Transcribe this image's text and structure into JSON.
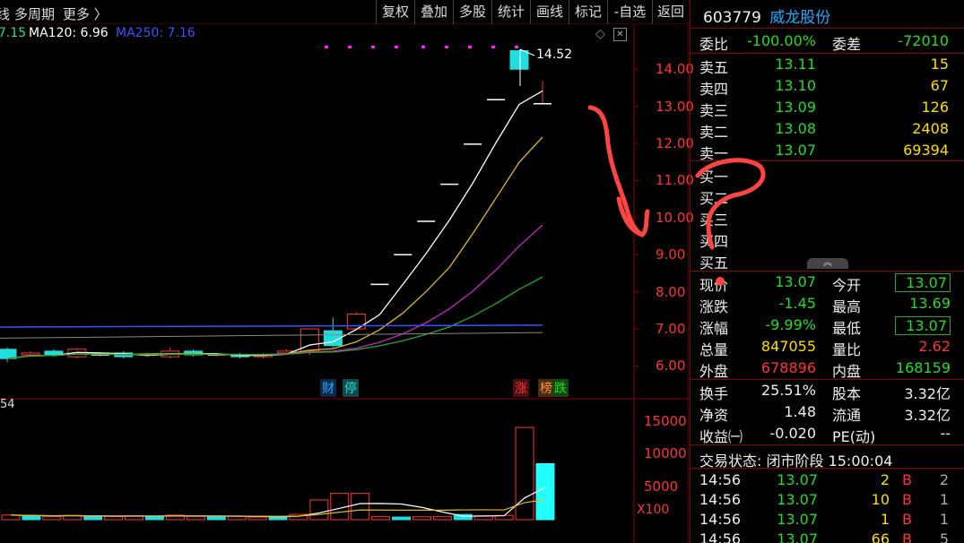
{
  "toolbar": {
    "left_items": [
      "线",
      "多周期",
      "更多 〉"
    ],
    "buttons": [
      "复权",
      "叠加",
      "多股",
      "统计",
      "画线",
      "标记",
      "-自选",
      "返回"
    ]
  },
  "ma_legend": [
    {
      "text": "7.15",
      "color": "#22dd99"
    },
    {
      "text": "MA120: 6.96",
      "color": "#ffffff"
    },
    {
      "text": "MA250: 7.16",
      "color": "#3355ff"
    }
  ],
  "chart_data": [
    {
      "type": "candlestick",
      "title": "",
      "y_axis_ticks": [
        "14.00",
        "13.00",
        "12.00",
        "11.00",
        "10.00",
        "9.00",
        "8.00",
        "7.00",
        "6.00"
      ],
      "ylim": [
        5.6,
        14.9
      ],
      "annotation_high": "14.52",
      "candles": [
        {
          "o": 6.45,
          "c": 6.2,
          "h": 6.5,
          "l": 6.1
        },
        {
          "o": 6.3,
          "c": 6.35,
          "h": 6.4,
          "l": 6.25
        },
        {
          "o": 6.4,
          "c": 6.3,
          "h": 6.45,
          "l": 6.25
        },
        {
          "o": 6.25,
          "c": 6.45,
          "h": 6.5,
          "l": 6.2
        },
        {
          "o": 6.3,
          "c": 6.3,
          "h": 6.35,
          "l": 6.25
        },
        {
          "o": 6.35,
          "c": 6.25,
          "h": 6.4,
          "l": 6.2
        },
        {
          "o": 6.3,
          "c": 6.3,
          "h": 6.35,
          "l": 6.25
        },
        {
          "o": 6.25,
          "c": 6.4,
          "h": 6.5,
          "l": 6.2
        },
        {
          "o": 6.4,
          "c": 6.3,
          "h": 6.45,
          "l": 6.25
        },
        {
          "o": 6.3,
          "c": 6.3,
          "h": 6.35,
          "l": 6.25
        },
        {
          "o": 6.3,
          "c": 6.25,
          "h": 6.35,
          "l": 6.2
        },
        {
          "o": 6.25,
          "c": 6.3,
          "h": 6.35,
          "l": 6.2
        },
        {
          "o": 6.35,
          "c": 6.4,
          "h": 6.45,
          "l": 6.3
        },
        {
          "o": 6.4,
          "c": 7.0,
          "h": 7.0,
          "l": 6.3
        },
        {
          "o": 6.95,
          "c": 6.55,
          "h": 7.3,
          "l": 6.5
        },
        {
          "o": 7.0,
          "c": 7.4,
          "h": 7.45,
          "l": 7.0
        },
        {
          "o": 8.2,
          "c": 8.2,
          "h": 8.2,
          "l": 8.2
        },
        {
          "o": 9.0,
          "c": 9.0,
          "h": 9.0,
          "l": 9.0
        },
        {
          "o": 9.9,
          "c": 9.9,
          "h": 9.9,
          "l": 9.9
        },
        {
          "o": 10.9,
          "c": 10.9,
          "h": 10.9,
          "l": 10.9
        },
        {
          "o": 11.98,
          "c": 11.98,
          "h": 11.98,
          "l": 11.98
        },
        {
          "o": 13.18,
          "c": 13.18,
          "h": 13.18,
          "l": 13.18
        },
        {
          "o": 14.5,
          "c": 14.0,
          "h": 14.52,
          "l": 14.0
        },
        {
          "o": 13.07,
          "c": 13.07,
          "h": 13.69,
          "l": 13.07
        }
      ],
      "bottom_tags": [
        {
          "text": "财",
          "color": "#22aaff",
          "bg": "#0a2a4a"
        },
        {
          "text": "停",
          "color": "#22dddd",
          "bg": "#104a4a"
        },
        {
          "text": "涨",
          "color": "#ff3333",
          "bg": "#4a1010"
        },
        {
          "text": "榜",
          "color": "#ff9933",
          "bg": "#4a2a10"
        },
        {
          "text": "跌",
          "color": "#22dd22",
          "bg": "#104a10"
        }
      ]
    },
    {
      "type": "bar",
      "title": "",
      "y_axis_ticks": [
        "15000",
        "10000",
        "5000"
      ],
      "unit": "X100",
      "top_left_label": "54",
      "volumes": [
        700,
        600,
        500,
        650,
        450,
        500,
        600,
        550,
        700,
        500,
        450,
        500,
        400,
        450,
        800,
        3000,
        4000,
        4000,
        500,
        400,
        450,
        500,
        800,
        600,
        650,
        14000,
        8500
      ]
    }
  ],
  "quote": {
    "code": "603779",
    "name": "威龙股份",
    "weibi_label": "委比",
    "weibi": "-100.00%",
    "weicha_label": "委差",
    "weicha": "-72010",
    "sells": [
      {
        "label": "卖五",
        "price": "13.11",
        "vol": "15"
      },
      {
        "label": "卖四",
        "price": "13.10",
        "vol": "67"
      },
      {
        "label": "卖三",
        "price": "13.09",
        "vol": "126"
      },
      {
        "label": "卖二",
        "price": "13.08",
        "vol": "2408"
      },
      {
        "label": "卖一",
        "price": "13.07",
        "vol": "69394"
      }
    ],
    "buys": [
      "买一",
      "买二",
      "买三",
      "买四",
      "买五"
    ],
    "stats": [
      {
        "l1": "现价",
        "v1": "13.07",
        "c1": "g",
        "l2": "今开",
        "v2": "13.07",
        "c2": "g",
        "b2": true
      },
      {
        "l1": "涨跌",
        "v1": "-1.45",
        "c1": "g",
        "l2": "最高",
        "v2": "13.69",
        "c2": "g",
        "b2": false
      },
      {
        "l1": "涨幅",
        "v1": "-9.99%",
        "c1": "g",
        "l2": "最低",
        "v2": "13.07",
        "c2": "g",
        "b2": true
      },
      {
        "l1": "总量",
        "v1": "847055",
        "c1": "y",
        "l2": "量比",
        "v2": "2.62",
        "c2": "rd",
        "b2": false
      },
      {
        "l1": "外盘",
        "v1": "678896",
        "c1": "rd",
        "l2": "内盘",
        "v2": "168159",
        "c2": "g",
        "b2": false
      }
    ],
    "fund": [
      {
        "l1": "换手",
        "v1": "25.51%",
        "l2": "股本",
        "v2": "3.32亿"
      },
      {
        "l1": "净资",
        "v1": "1.48",
        "l2": "流通",
        "v2": "3.32亿"
      },
      {
        "l1": "收益㈠",
        "v1": "-0.020",
        "l2": "PE(动)",
        "v2": "--"
      }
    ],
    "status": "交易状态: 闭市阶段 15:00:04",
    "ticks": [
      {
        "time": "14:56",
        "price": "13.07",
        "vol": "2",
        "bs": "B",
        "n": "2"
      },
      {
        "time": "14:56",
        "price": "13.07",
        "vol": "10",
        "bs": "B",
        "n": "1"
      },
      {
        "time": "14:56",
        "price": "13.07",
        "vol": "1",
        "bs": "B",
        "n": "1"
      },
      {
        "time": "14:56",
        "price": "13.07",
        "vol": "66",
        "bs": "B",
        "n": "5"
      }
    ]
  }
}
